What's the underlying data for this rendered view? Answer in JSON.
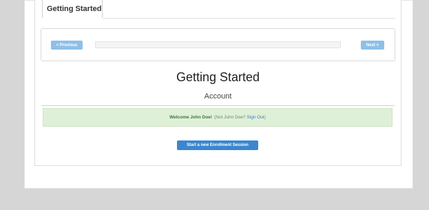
{
  "tab": {
    "label": "Getting Started"
  },
  "nav": {
    "previous_label": "< Previous",
    "next_label": "Next >",
    "progress_fraction": 0.0
  },
  "main": {
    "title": "Getting Started",
    "subtitle": "Account"
  },
  "alert": {
    "welcome": "Welcome John Doe!",
    "not_user": "(Not John Doe?",
    "sign_out": "Sign Out",
    "close_paren": ")"
  },
  "actions": {
    "start_label": "Start a new Enrollment Session"
  },
  "colors": {
    "accent_blue": "#3a87cf",
    "light_blue": "#8fbfe8",
    "alert_bg": "#dff0d8",
    "alert_text": "#3c763d",
    "link": "#3a7fc1"
  }
}
